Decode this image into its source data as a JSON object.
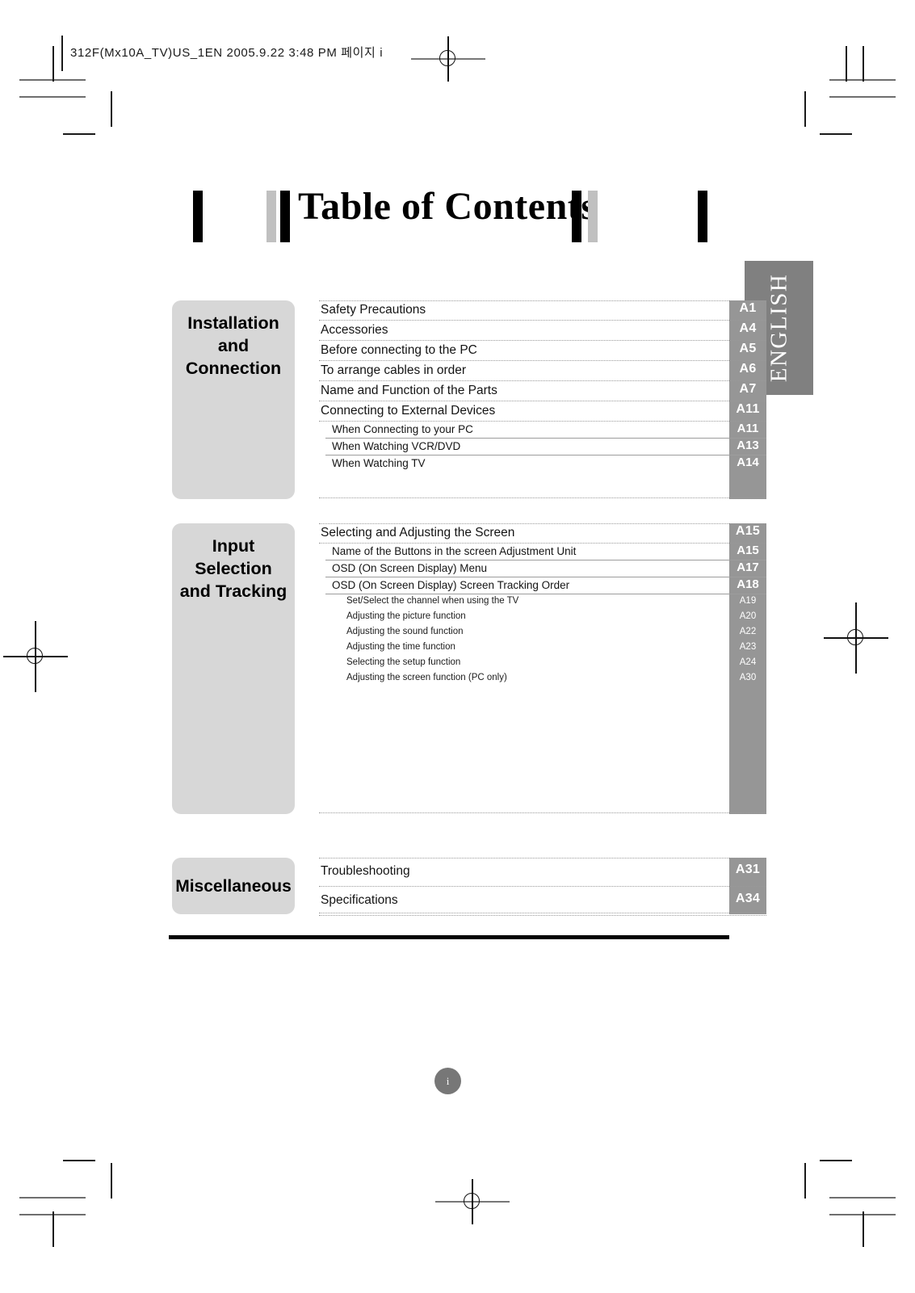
{
  "running_head": "312F(Mx10A_TV)US_1EN  2005.9.22  3:48 PM  페이지 i",
  "title": "Table of Contents",
  "language_tab": "ENGLISH",
  "folio": "i",
  "colors": {
    "category_box": "#d7d7d7",
    "page_column": "#969696",
    "language_tab": "#808080",
    "leader_dotted": "#9a9a9a",
    "rule_solid": "#9d9d9d",
    "bottom_rule": "#000000"
  },
  "sections": [
    {
      "category": "Installation\nand\nConnection",
      "entries": [
        {
          "level": 1,
          "label": "Safety Precautions",
          "page": "A1"
        },
        {
          "level": 1,
          "label": "Accessories",
          "page": "A4"
        },
        {
          "level": 1,
          "label": "Before connecting to the PC",
          "page": "A5"
        },
        {
          "level": 1,
          "label": "To arrange cables in order",
          "page": "A6"
        },
        {
          "level": 1,
          "label": "Name and Function of the Parts",
          "page": "A7"
        },
        {
          "level": 1,
          "label": "Connecting to External Devices",
          "page": "A11"
        },
        {
          "level": 2,
          "label": "When Connecting to your PC",
          "page": "A11"
        },
        {
          "level": 2,
          "label": "When Watching VCR/DVD",
          "page": "A13"
        },
        {
          "level": 2,
          "label": "When Watching TV",
          "page": "A14"
        }
      ]
    },
    {
      "category": "Input\nSelection\nand Tracking",
      "entries": [
        {
          "level": 1,
          "label": "Selecting and Adjusting the Screen",
          "page": "A15"
        },
        {
          "level": 2,
          "label": "Name of the Buttons in the screen Adjustment Unit",
          "page": "A15"
        },
        {
          "level": 2,
          "label": "OSD (On Screen Display) Menu",
          "page": "A17"
        },
        {
          "level": 2,
          "label": "OSD (On Screen Display) Screen Tracking Order",
          "page": "A18"
        },
        {
          "level": 3,
          "label": "Set/Select the channel when using the TV",
          "page": "A19"
        },
        {
          "level": 3,
          "label": "Adjusting the picture function",
          "page": "A20"
        },
        {
          "level": 3,
          "label": "Adjusting the sound function",
          "page": "A22"
        },
        {
          "level": 3,
          "label": "Adjusting the time function",
          "page": "A23"
        },
        {
          "level": 3,
          "label": "Selecting the setup function",
          "page": "A24"
        },
        {
          "level": 3,
          "label": "Adjusting the screen function (PC only)",
          "page": "A30"
        }
      ]
    },
    {
      "category": "Miscellaneous",
      "entries": [
        {
          "level": 1,
          "label": "Troubleshooting",
          "page": "A31"
        },
        {
          "level": 1,
          "label": "Specifications",
          "page": "A34"
        }
      ]
    }
  ]
}
